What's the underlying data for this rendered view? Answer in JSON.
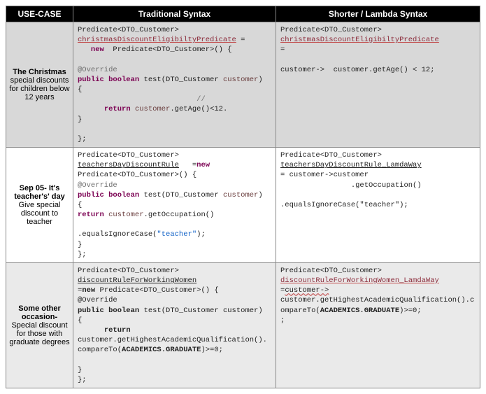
{
  "headers": {
    "usecase": "USE-CASE",
    "traditional": "Traditional Syntax",
    "lambda": "Shorter / Lambda Syntax"
  },
  "rows": [
    {
      "usecase_title": "The Christmas",
      "usecase_desc": "special discounts for children below 12 years",
      "trad_l1a": "Predicate<DTO_Customer> ",
      "trad_l1b": "christmasDiscountEligibiltyPredicate",
      "trad_l1c": " =",
      "trad_l2a": "   ",
      "trad_l2b": "new",
      "trad_l2c": "  Predicate<DTO_Customer>() {",
      "trad_l3": "",
      "trad_l4": "@Override",
      "trad_l5a": "public boolean",
      "trad_l5b": " test(DTO_Customer ",
      "trad_l5c": "customer",
      "trad_l5d": ") {",
      "trad_l6": "                           //",
      "trad_l7a": "      ",
      "trad_l7b": "return",
      "trad_l7c": " ",
      "trad_l7d": "customer",
      "trad_l7e": ".getAge()<12.",
      "trad_l8": "}",
      "trad_l9": "",
      "trad_l10": "};",
      "lam_l1": "Predicate<DTO_Customer> ",
      "lam_l1b": "christmasDiscountEligibiltyPredicate",
      "lam_l2": "=",
      "lam_l3": "",
      "lam_l4": "customer->  customer.getAge() < 12;"
    },
    {
      "usecase_title": "Sep 05- It's teacher's' day",
      "usecase_desc": "Give special discount to teacher",
      "trad_l1a": "Predicate<DTO_Customer> ",
      "trad_l1b": "teachersDayDiscountRule",
      "trad_l1c": "   =",
      "trad_l1d": "new",
      "trad_l2": "Predicate<DTO_Customer>() {",
      "trad_l3": "@Override",
      "trad_l4a": "public boolean",
      "trad_l4b": " test(DTO_Customer ",
      "trad_l4c": "customer",
      "trad_l4d": ") {",
      "trad_l5a": "return",
      "trad_l5b": " ",
      "trad_l5c": "customer",
      "trad_l5d": ".getOccupation()",
      "trad_l6": "",
      "trad_l7a": ".equalsIgnoreCase(",
      "trad_l7b": "\"teacher\"",
      "trad_l7c": ");",
      "trad_l8": "}",
      "trad_l9": "};",
      "lam_l1": "Predicate<DTO_Customer> ",
      "lam_l2": "teachersDayDiscountRule_LamdaWay",
      "lam_l3": "= customer->customer",
      "lam_l4": "                .getOccupation()",
      "lam_l5": "                .equalsIgnoreCase(\"teacher\");"
    },
    {
      "usecase_title": "Some other occasion-",
      "usecase_desc": "Special discount for those with graduate degrees",
      "trad_l1": "Predicate<DTO_Customer> ",
      "trad_l2": "discountRuleForWorkingWomen",
      "trad_l3a": "=",
      "trad_l3b": "new",
      "trad_l3c": " Predicate<DTO_Customer>() {",
      "trad_l4": "@Override",
      "trad_l5a": "public boolean",
      "trad_l5b": " test(DTO_Customer customer) {",
      "trad_l6a": "      ",
      "trad_l6b": "return",
      "trad_l7": "customer.getHighestAcademicQualification().compareTo(",
      "trad_l7b": "ACADEMICS.GRADUATE",
      "trad_l7c": ")>=0;",
      "trad_l8": "",
      "trad_l9": "}",
      "trad_l10": "};",
      "lam_l1": "Predicate<DTO_Customer> ",
      "lam_l2": "discountRuleForWorkingWomen_LamdaWay",
      "lam_l3a": "=",
      "lam_l3b": "customer->",
      "lam_l4": "customer.getHighestAcademicQualification().compareTo(",
      "lam_l4b": "ACADEMICS.GRADUATE",
      "lam_l4c": ")>=0;",
      "lam_l5": ";"
    }
  ]
}
